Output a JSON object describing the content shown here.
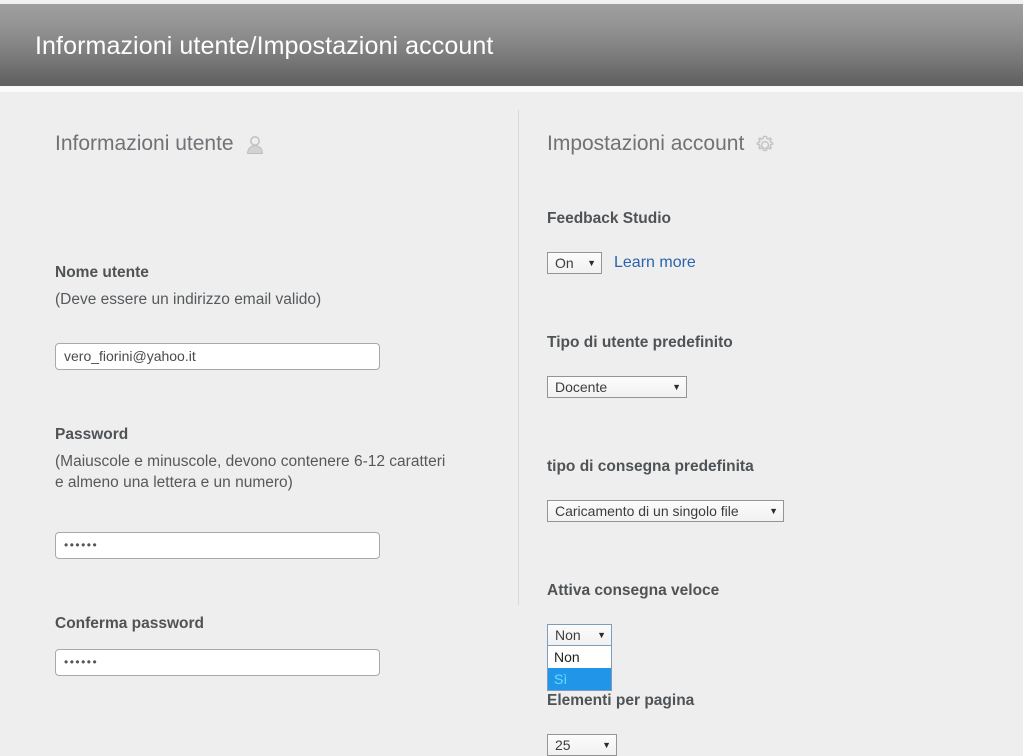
{
  "header": {
    "title": "Informazioni utente/Impostazioni account"
  },
  "left_column": {
    "section_title": "Informazioni utente",
    "section_icon": "user-icon",
    "username": {
      "label": "Nome utente",
      "hint": "(Deve essere un indirizzo email valido)",
      "value": "vero_fiorini@yahoo.it"
    },
    "password": {
      "label": "Password",
      "hint": "(Maiuscole e minuscole, devono contenere 6-12 caratteri e almeno una lettera e un numero)",
      "value": "••••••"
    },
    "confirm_password": {
      "label": "Conferma password",
      "value": "••••••"
    }
  },
  "right_column": {
    "section_title": "Impostazioni account",
    "section_icon": "gear-icon",
    "feedback_studio": {
      "label": "Feedback Studio",
      "value": "On",
      "link_label": "Learn more"
    },
    "default_user_type": {
      "label": "Tipo di utente predefinito",
      "value": "Docente"
    },
    "default_submission_type": {
      "label": "tipo di consegna predefinita",
      "value": "Caricamento di un singolo file"
    },
    "quick_submit": {
      "label": "Attiva consegna veloce",
      "value": "Non",
      "open": true,
      "options": [
        {
          "label": "Non",
          "selected": false
        },
        {
          "label": "Sì",
          "selected": true
        }
      ]
    },
    "items_per_page": {
      "label": "Elementi per pagina",
      "value": "25"
    }
  },
  "icons": {
    "caret_down": "▼"
  },
  "colors": {
    "header_gradient_top": "#9e9e9e",
    "header_gradient_bottom": "#616161",
    "page_background": "#eeeeee",
    "link_blue": "#2a64ad",
    "dropdown_highlight": "#2196e8",
    "label_text": "#4f5356",
    "section_title_text": "#6f7276"
  }
}
